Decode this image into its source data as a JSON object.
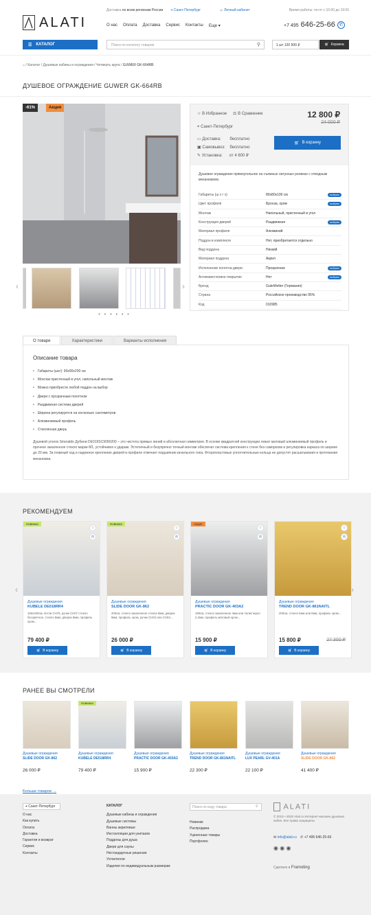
{
  "header": {
    "delivery_prefix": "Доставка",
    "delivery_text": "по всем регионам России",
    "city": "Санкт-Петербург",
    "account": "Личный кабинет",
    "hours": "Время работы: пн-пт с 10:00 до 19:00",
    "logo": "ALATI",
    "nav": [
      "О нас",
      "Оплата",
      "Доставка",
      "Сервис",
      "Контакты",
      "Еще"
    ],
    "phone_prefix": "+7 495",
    "phone": "646-25-66",
    "catalog": "КАТАЛОГ",
    "search_placeholder": "Поиск по каталогу товаров",
    "cart_total": "1 шт 120 500 ₽",
    "cart": "Корзина"
  },
  "breadcrumb": [
    "Каталог",
    "Душевые кабины и ограждения",
    "Четверть круга",
    "GUWER GK-664RB"
  ],
  "product": {
    "title": "ДУШЕВОЕ ОГРАЖДЕНИЕ GUWER GK-664RB",
    "discount": "-61%",
    "promo": "Акция",
    "fav": "В Избранное",
    "compare": "В Сравнение",
    "price": "12 800 ₽",
    "old_price": "24 000 ₽",
    "city": "Санкт-Петербург",
    "delivery": [
      {
        "k": "Доставка:",
        "v": "бесплатно"
      },
      {
        "k": "Самовывоз:",
        "v": "бесплатно"
      },
      {
        "k": "Установка:",
        "v": "от 4 600 ₽"
      }
    ],
    "buy": "В корзину",
    "summary": "Душевое ограждение прямоугольное на съемных латунных роликах с отводным механизмом.",
    "specs": [
      {
        "k": "Габариты (ш х г х)",
        "v": "80х80х100 см",
        "pick": true
      },
      {
        "k": "Цвет профиля",
        "v": "Бронза, хром",
        "pick": true
      },
      {
        "k": "Монтаж",
        "v": "Напольный, пристенный в угол",
        "pick": false
      },
      {
        "k": "Конструкция дверей",
        "v": "Раздвижная",
        "pick": true
      },
      {
        "k": "Материал профиля",
        "v": "Алюминий",
        "pick": false
      },
      {
        "k": "Поддон в комплекте",
        "v": "Нет, приобретается отдельно",
        "pick": false
      },
      {
        "k": "Вид поддона",
        "v": "Низкий",
        "pick": false
      },
      {
        "k": "Материал поддона",
        "v": "Акрил",
        "pick": false
      },
      {
        "k": "Исполнение полотна двери",
        "v": "Прозрачная",
        "pick": true
      },
      {
        "k": "Антиизвестковое покрытие",
        "v": "Нет",
        "pick": true
      },
      {
        "k": "Бренд",
        "v": "GuteWetter (Германия)",
        "pick": false
      },
      {
        "k": "Страна",
        "v": "Российское производство 95%",
        "pick": false
      },
      {
        "k": "Код",
        "v": "010985",
        "pick": false
      }
    ],
    "pick_label": "выбрать"
  },
  "tabs": [
    "О товаре",
    "Характеристики",
    "Варианты исполнения"
  ],
  "description": {
    "title": "Описание товара",
    "bullets": [
      "Габариты (шхг): 90х90х200 см",
      "Монтаж пристенный в угол, напольный монтаж",
      "Можно приобрести любой поддон на выбор",
      "Двери с прозрачным полотном",
      "Раздвижная система дверей",
      "Ширина регулируется на несколько сантиметров",
      "Алюминиевый профиль",
      "Стеклянная дверь"
    ],
    "text": "Душевой уголок Smeraldo Дубини DE019SC9090200 – это чистота прямых линий и абсолютная симметрия. В основе квадратной конструкции лежат матовый алюминиевый профиль и прочное закаленное стекло марки М1, устойчивое к ударам. Эстетичный и безупречно точный монтаж обеспечат система крепления к стене без саморезов и регулировка каркаса по ширине до 20 мм. За плавный ход и надежное крепление дверей в профиле отвечает подшипник качального типа. Фторопластовые уплотнительные кольца не допустят расшатывания и протекания механизма."
  },
  "recommended": {
    "title": "РЕКОМЕНДУЕМ",
    "buy": "В корзину",
    "items": [
      {
        "tag": "Новинка",
        "cat": "Душевые ограждения",
        "name": "KUBELE DE018RR4",
        "desc": "160х200см, петли CH75, ручки CH07 стекло бесцветное, стекло 8мм, дверка 8мм, профиль хром...",
        "price": "79 400 ₽",
        "old": ""
      },
      {
        "tag": "Новинка",
        "cat": "Душевые ограждения",
        "name": "SLIDE DOOR GK-862",
        "desc": "200см, стекло закаленное стекла 8мм, дверка 8мм, профиль хром, ручки CH02 или CH04...",
        "price": "26 000 ₽",
        "old": ""
      },
      {
        "tag": "Акция",
        "cat": "Душевые ограждения",
        "name": "PRACTIC DOOR GK-403A2",
        "desc": "190см, стекло закаленное 4мм или полистирол 2,2мм, профиль матовый хром...",
        "price": "15 900 ₽",
        "old": ""
      },
      {
        "tag": "",
        "cat": "Душевые ограждения",
        "name": "TREND DOOR GK-861NAITL",
        "desc": "200см, стекло 6мм или 8мм, профиль хром...",
        "price": "15 800 ₽",
        "old": "27 300 ₽"
      }
    ]
  },
  "viewed": {
    "title": "РАНЕЕ ВЫ СМОТРЕЛИ",
    "items": [
      {
        "tag": "",
        "cat": "Душевые ограждения",
        "name": "SLIDE DOOR GK-862",
        "price": "26 000 ₽"
      },
      {
        "tag": "Новинка",
        "cat": "Душевые ограждения",
        "name": "KUBELE DE018RR4",
        "price": "79 400 ₽"
      },
      {
        "tag": "",
        "cat": "Душевые ограждения",
        "name": "PRACTIC DOOR GK-403A2",
        "price": "15 900 ₽"
      },
      {
        "tag": "",
        "cat": "Душевые ограждения",
        "name": "TREND DOOR GK-861NAITL",
        "price": "22 300 ₽"
      },
      {
        "tag": "",
        "cat": "Душевые ограждения",
        "name": "LUX PEARL GV-401A",
        "price": "22 100 ₽"
      },
      {
        "tag": "",
        "cat": "Душевые ограждения",
        "name": "SLIDE DOOR GK-862",
        "price": "41 400 ₽"
      }
    ],
    "more": "Больше товаров"
  },
  "footer": {
    "city": "Санкт-Петербург",
    "col1": [
      "О нас",
      "Как купить",
      "Оплата",
      "Доставка",
      "Гарантия и возврат",
      "Сервис",
      "Контакты"
    ],
    "catalog_title": "КАТАЛОГ",
    "col2": [
      "Душевые кабины и ограждения",
      "Душевые системы",
      "Ванны акриловые",
      "Инсталляции для унитазов",
      "Поддоны для душа",
      "Двери для сауны",
      "Нестандартные решения",
      "Ухтоителли",
      "Изделия по индивидуальным размерам"
    ],
    "search_placeholder": "Поиск по коду товара",
    "col3": [
      "Новинки",
      "Распродажа",
      "Уцененные товары",
      "Портфолио"
    ],
    "logo": "ALATI",
    "copy": "© 2012—2020 Alati.ru Интернет-магазин душевых кабин. Все права защищены",
    "email": "info@alati.ru",
    "phone": "+7 495 646-25-66",
    "made": "Сделано в",
    "made_brand": "Framoting"
  },
  "colors": {
    "accent": "#1c6fc4",
    "new": "#c6e86b",
    "sale": "#f28c3a",
    "discount": "#333333"
  }
}
